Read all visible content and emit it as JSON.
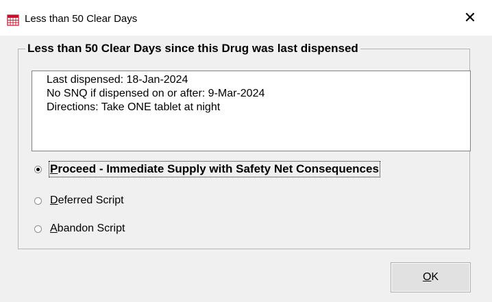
{
  "window": {
    "title": "Less than 50 Clear Days",
    "icon": "calendar-icon",
    "close_glyph": "✕"
  },
  "group": {
    "legend": "Less than 50 Clear Days since this Drug was last dispensed"
  },
  "info": {
    "lines": [
      "Last dispensed: 18-Jan-2024",
      "No SNQ if dispensed on or after: 9-Mar-2024",
      "Directions: Take ONE tablet at night"
    ]
  },
  "options": [
    {
      "mnemonic": "P",
      "rest": "roceed - Immediate Supply with Safety Net Consequences",
      "selected": true
    },
    {
      "mnemonic": "D",
      "rest": "eferred Script",
      "selected": false
    },
    {
      "mnemonic": "A",
      "rest": "bandon Script",
      "selected": false
    }
  ],
  "buttons": {
    "ok": {
      "mnemonic": "O",
      "rest": "K"
    }
  },
  "colors": {
    "dialog_bg": "#f0f0f0",
    "titlebar_bg": "#ffffff",
    "calendar_icon_red": "#c8102e"
  }
}
